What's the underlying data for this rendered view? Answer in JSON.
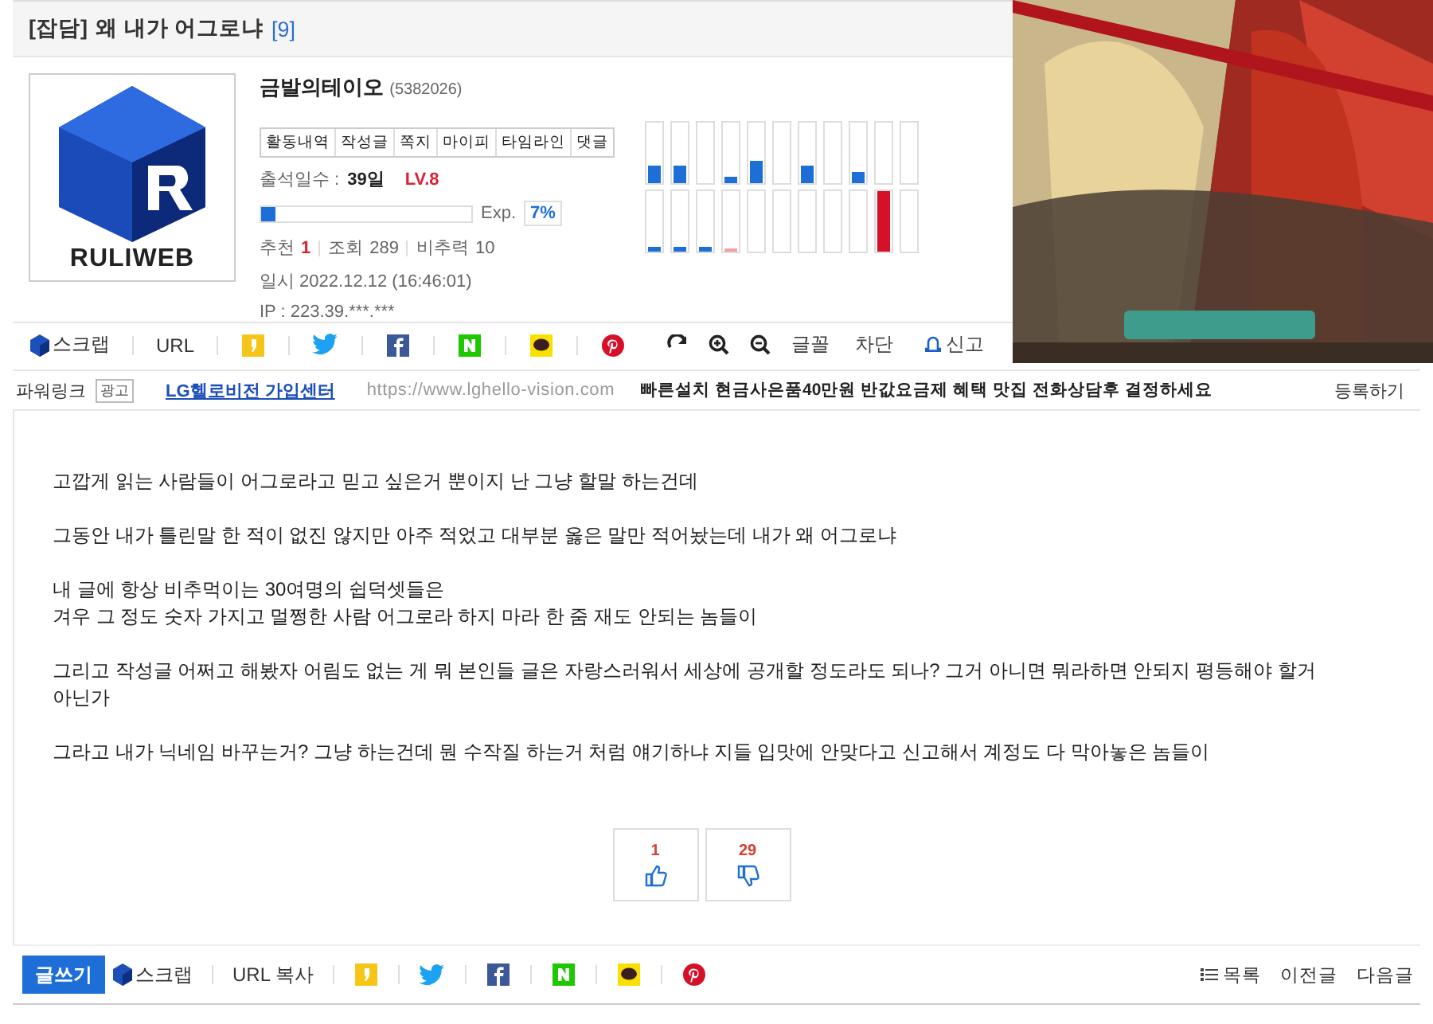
{
  "title": {
    "category": "[잡담]",
    "text": "왜 내가 어그로냐",
    "comment_count": "[9]"
  },
  "profile": {
    "logo_text": "RULIWEB",
    "nickname": "금발의테이오",
    "member_id": "(5382026)",
    "tabs": [
      "활동내역",
      "작성글",
      "쪽지",
      "마이피",
      "타임라인",
      "댓글"
    ],
    "attendance_label": "출석일수 :",
    "attendance_value": "39일",
    "rank": "LV.8",
    "exp": {
      "level": 0.07,
      "label": "Exp.",
      "reading": "7%"
    },
    "stats": [
      {
        "label": "추천",
        "value": "1",
        "highlight": true
      },
      {
        "label": "조회",
        "value": "289",
        "highlight": false
      },
      {
        "label": "비추력",
        "value": "10",
        "highlight": false
      }
    ],
    "date": "일시 2022.12.12 (16:46:01)",
    "ip": "IP : 223.39.***.***"
  },
  "share_bar": {
    "items": [
      {
        "kind": "scrap",
        "label": "스크랩"
      },
      {
        "kind": "text",
        "label": "URL"
      },
      {
        "kind": "kakaostory"
      },
      {
        "kind": "twitter"
      },
      {
        "kind": "facebook"
      },
      {
        "kind": "naver"
      },
      {
        "kind": "kakaotalk"
      },
      {
        "kind": "pinterest"
      }
    ],
    "tools": [
      {
        "kind": "refresh"
      },
      {
        "kind": "zoom-in"
      },
      {
        "kind": "zoom-out"
      },
      {
        "kind": "text",
        "label": "글꼴"
      }
    ],
    "actions": [
      {
        "kind": "text",
        "label": "차단"
      },
      {
        "kind": "bell",
        "label": "신고"
      }
    ]
  },
  "ad": {
    "kind": "picture"
  },
  "power_link": {
    "label": "파워링크",
    "badge": "광고",
    "link": "LG헬로비전 가입센터",
    "url": "https://www.lghello-vision.com",
    "description": "빠른설치 현금사은품40만원 반값요금제 혜택 맛집 전화상담후 결정하세요",
    "register": "등록하기"
  },
  "body": [
    [
      "고깝게 읽는 사람들이 어그로라고 믿고 싶은거 뿐이지 난 그냥 할말 하는건데"
    ],
    [
      "그동안 내가 틀린말 한 적이 없진 않지만 아주 적었고 대부분 옳은 말만 적어놨는데 내가 왜 어그로냐"
    ],
    [
      "내 글에 항상 비추먹이는 30여명의 쉽덕셋들은",
      "겨우 그 정도 숫자 가지고 멀쩡한 사람 어그로라 하지 마라 한 줌 재도 안되는 놈들이"
    ],
    [
      "그리고 작성글 어쩌고 해봤자 어림도 없는 게 뭐 본인들 글은 자랑스러워서 세상에 공개할 정도라도 되나? 그거 아니면 뭐라하면 안되지 평등해야 할거",
      "아닌가"
    ],
    [
      "그라고 내가 닉네임 바꾸는거? 그냥 하는건데 뭔 수작질 하는거 처럼 얘기하냐 지들 입맛에 안맞다고 신고해서 계정도 다 막아놓은 놈들이"
    ]
  ],
  "votes": [
    {
      "kind": "up",
      "count": "1"
    },
    {
      "kind": "down",
      "count": "29"
    }
  ],
  "bottom_bar": {
    "write": "글쓰기",
    "items": [
      {
        "kind": "scrap",
        "label": "스크랩"
      },
      {
        "kind": "text",
        "label": "URL 복사"
      },
      {
        "kind": "kakaostory"
      },
      {
        "kind": "twitter"
      },
      {
        "kind": "facebook"
      },
      {
        "kind": "naver"
      },
      {
        "kind": "kakaotalk"
      },
      {
        "kind": "pinterest"
      }
    ],
    "nav": [
      {
        "kind": "list",
        "label": "목록"
      },
      {
        "kind": "text",
        "label": "이전글"
      },
      {
        "kind": "text",
        "label": "다음글"
      }
    ]
  }
}
